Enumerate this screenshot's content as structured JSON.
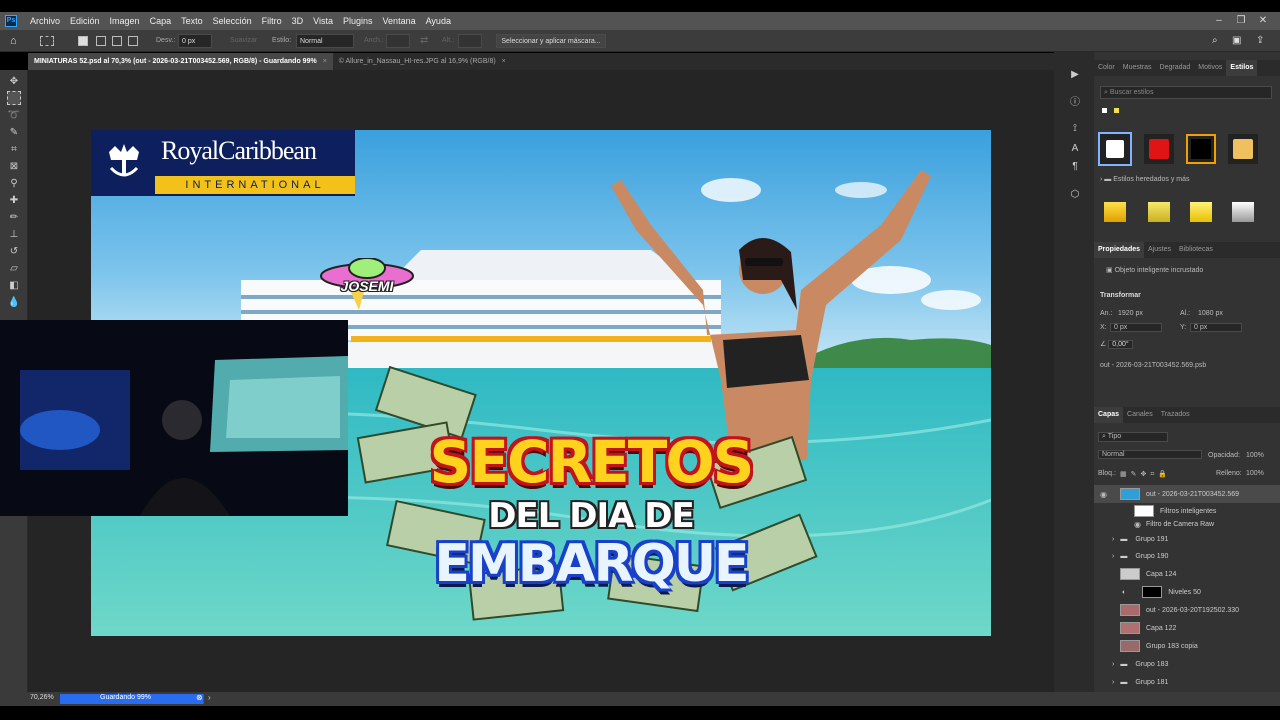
{
  "app": {
    "logo": "Ps"
  },
  "menu": [
    "Archivo",
    "Edición",
    "Imagen",
    "Capa",
    "Texto",
    "Selección",
    "Filtro",
    "3D",
    "Vista",
    "Plugins",
    "Ventana",
    "Ayuda"
  ],
  "options_bar": {
    "desvan_label": "Desv.:",
    "desvan_value": "0 px",
    "suavizar_label": "Suavizar",
    "estilo_label": "Estilo:",
    "estilo_value": "Normal",
    "anch_label": "Anch.:",
    "alt_label": "Alt.:",
    "mask_button": "Seleccionar y aplicar máscara..."
  },
  "tabs": [
    {
      "label": "MINIATURAS 52.psd al 70,3% (out - 2026-03-21T003452.569, RGB/8) - Guardando 99%",
      "close": "×"
    },
    {
      "label": "© Allure_in_Nassau_HI-res.JPG al 16,9% (RGB/8)",
      "close": "×"
    }
  ],
  "thumbnail": {
    "brand_line1": "RoyalCaribbean",
    "brand_line2": "INTERNATIONAL",
    "sticker": "JOSEMI",
    "title1": "SECRETOS",
    "title2": "DEL DIA DE",
    "title3": "EMBARQUE"
  },
  "styles_panel": {
    "tabs": [
      "Color",
      "Muestras",
      "Degradad",
      "Motivos",
      "Estilos"
    ],
    "active_tab": "Estilos",
    "search_placeholder": "Buscar estilos",
    "group_label": "Estilos heredados y más",
    "swatch_colors": [
      "#ffffff",
      "#e01414",
      "#f0a000",
      "#f0c060"
    ]
  },
  "properties_panel": {
    "tabs": [
      "Propiedades",
      "Ajustes",
      "Bibliotecas"
    ],
    "object_type": "Objeto inteligente incrustado",
    "transform_title": "Transformar",
    "an_label": "An.:",
    "an_value": "1920 px",
    "al_label": "Al.:",
    "al_value": "1080 px",
    "x_label": "X:",
    "x_value": "0 px",
    "y_label": "Y:",
    "y_value": "0 px",
    "angle_value": "0,00°",
    "filename": "out - 2026-03-21T003452.569.psb"
  },
  "layers_panel": {
    "tabs": [
      "Capas",
      "Canales",
      "Trazados"
    ],
    "filter_label": "Tipo",
    "blend_mode": "Normal",
    "opacity_label": "Opacidad:",
    "opacity_value": "100%",
    "lock_label": "Bloq.:",
    "fill_label": "Relleno:",
    "fill_value": "100%",
    "layers": [
      {
        "name": "out - 2026-03-21T003452.569",
        "kind": "smart",
        "selected": true
      },
      {
        "name": "Filtros inteligentes",
        "kind": "sub"
      },
      {
        "name": "Filtro de Camera Raw",
        "kind": "sub2"
      },
      {
        "name": "Grupo 191",
        "kind": "group"
      },
      {
        "name": "Grupo 190",
        "kind": "group"
      },
      {
        "name": "Capa 124",
        "kind": "layer"
      },
      {
        "name": "Niveles 50",
        "kind": "adjust"
      },
      {
        "name": "out - 2026-03-20T192502.330",
        "kind": "smart"
      },
      {
        "name": "Capa 122",
        "kind": "layer"
      },
      {
        "name": "Grupo 183 copia",
        "kind": "smart"
      },
      {
        "name": "Grupo 183",
        "kind": "group"
      },
      {
        "name": "Grupo 181",
        "kind": "group"
      }
    ]
  },
  "status": {
    "zoom": "70,26%",
    "saving": "Guardando 99%",
    "saving_progress": 0.99
  }
}
